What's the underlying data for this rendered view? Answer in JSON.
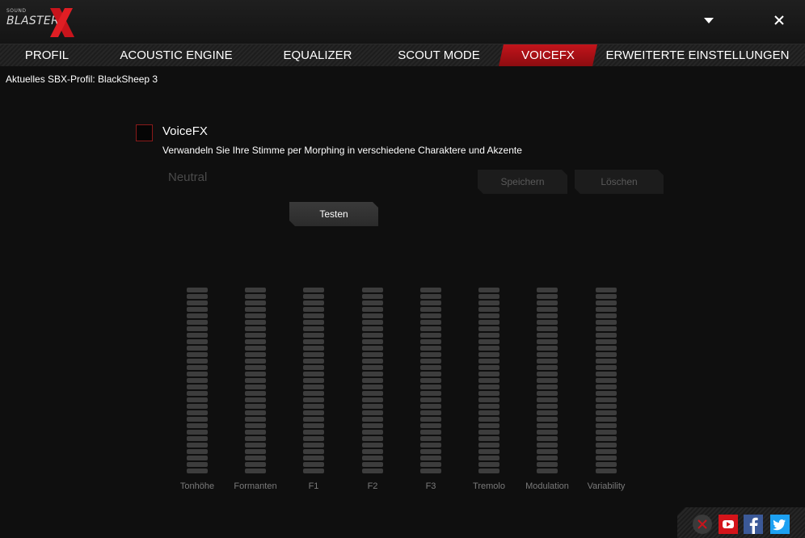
{
  "app": {
    "logo_small": "SOUND",
    "logo_main": "BLASTER",
    "brand_color": "#c8141c"
  },
  "tabs": [
    {
      "label": "PROFIL",
      "active": false
    },
    {
      "label": "ACOUSTIC ENGINE",
      "active": false
    },
    {
      "label": "EQUALIZER",
      "active": false
    },
    {
      "label": "SCOUT MODE",
      "active": false
    },
    {
      "label": "VOICEFX",
      "active": true
    },
    {
      "label": "ERWEITERTE EINSTELLUNGEN",
      "active": false
    }
  ],
  "profile_line": "Aktuelles SBX-Profil: BlackSheep 3",
  "voicefx": {
    "enabled": false,
    "title": "VoiceFX",
    "description": "Verwandeln Sie Ihre Stimme per Morphing in verschiedene Charaktere und Akzente",
    "preset": "Neutral",
    "save_label": "Speichern",
    "delete_label": "Löschen",
    "test_label": "Testen"
  },
  "sliders": [
    {
      "label": "Tonhöhe"
    },
    {
      "label": "Formanten"
    },
    {
      "label": "F1"
    },
    {
      "label": "F2"
    },
    {
      "label": "F3"
    },
    {
      "label": "Tremolo"
    },
    {
      "label": "Modulation"
    },
    {
      "label": "Variability"
    }
  ],
  "social": [
    "close-circle-icon",
    "youtube-icon",
    "facebook-icon",
    "twitter-icon"
  ]
}
